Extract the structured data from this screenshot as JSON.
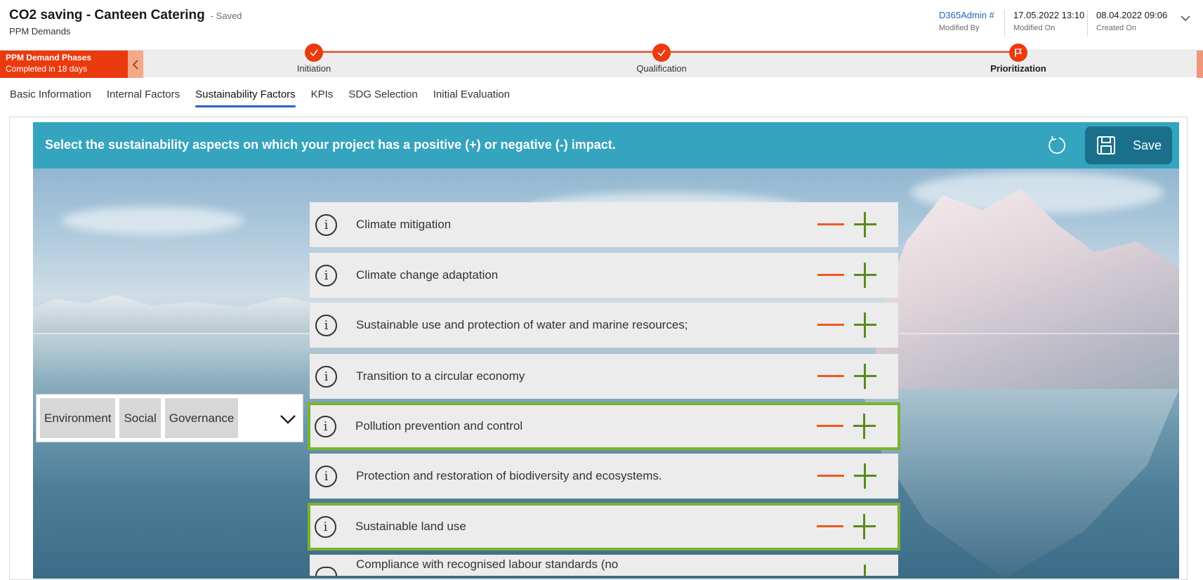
{
  "header": {
    "title": "CO2 saving - Canteen Catering",
    "status": "- Saved",
    "entity": "PPM Demands",
    "meta": [
      {
        "value": "D365Admin #",
        "label": "Modified By"
      },
      {
        "value": "17.05.2022 13:10",
        "label": "Modified On"
      },
      {
        "value": "08.04.2022 09:06",
        "label": "Created On"
      }
    ]
  },
  "process": {
    "label": "PPM Demand Phases",
    "sublabel": "Completed in 18 days",
    "stages": [
      {
        "name": "Initiation",
        "state": "completed"
      },
      {
        "name": "Qualification",
        "state": "completed"
      },
      {
        "name": "Prioritization",
        "state": "active"
      }
    ]
  },
  "tabs": [
    {
      "label": "Basic Information"
    },
    {
      "label": "Internal Factors"
    },
    {
      "label": "Sustainability Factors",
      "active": true
    },
    {
      "label": "KPIs"
    },
    {
      "label": "SDG Selection"
    },
    {
      "label": "Initial Evaluation"
    }
  ],
  "banner": {
    "text": "Select the sustainability aspects on which your project has a positive (+) or negative (-) impact.",
    "save_label": "Save"
  },
  "esg": {
    "options": [
      "Environment",
      "Social",
      "Governance"
    ]
  },
  "aspects": [
    {
      "label": "Climate mitigation",
      "selected": false
    },
    {
      "label": "Climate change adaptation",
      "selected": false
    },
    {
      "label": "Sustainable use and protection of water and marine resources;",
      "selected": false
    },
    {
      "label": "Transition to a circular economy",
      "selected": false
    },
    {
      "label": "Pollution prevention and control",
      "selected": true
    },
    {
      "label": "Protection and restoration of biodiversity and ecosystems.",
      "selected": false
    },
    {
      "label": "Sustainable land use",
      "selected": true
    },
    {
      "label": "Compliance with recognised labour standards (no",
      "selected": false
    }
  ],
  "colors": {
    "accent": "#ea3a0e",
    "banner": "#34a4bf",
    "save": "#1a6f8a",
    "selected_outline": "#7ab32e",
    "minus": "#ea5a1e",
    "plus": "#5a8a1e",
    "link": "#2266b8"
  }
}
